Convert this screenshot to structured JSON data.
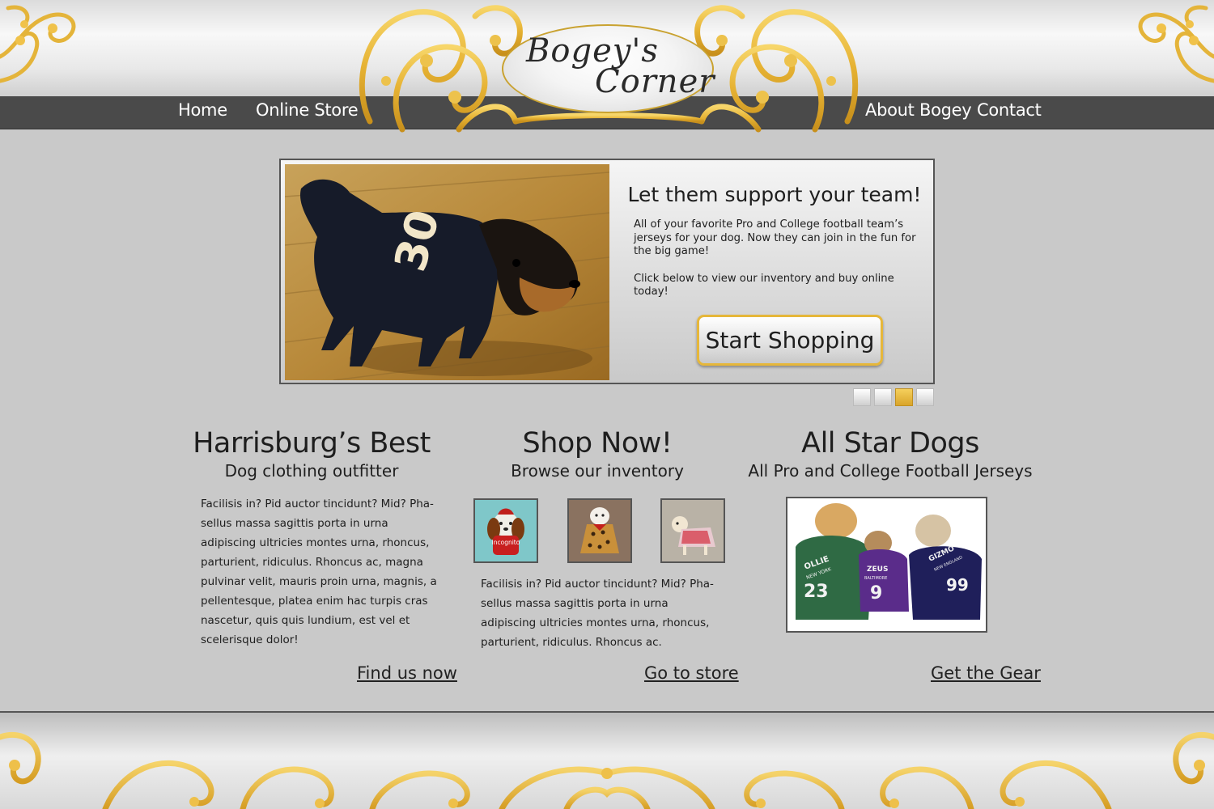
{
  "brand": {
    "logo_line1": "Bogey's",
    "logo_line2": "Corner"
  },
  "nav": {
    "home": "Home",
    "store": "Online Store",
    "about": "About Bogey",
    "contact": "Contact"
  },
  "hero": {
    "title": "Let them support your team!",
    "paragraph1": "All of your favorite Pro and College football team’s jerseys for your dog.  Now they can join in the fun for the big game!",
    "paragraph2": "Click below to view our inventory and buy online today!",
    "button_label": "Start Shopping",
    "slides_count": 4,
    "active_slide": 3
  },
  "columns": {
    "left": {
      "title": "Harrisburg’s Best",
      "subtitle": "Dog clothing outfitter",
      "text": "Facilisis in? Pid auctor tincidunt? Mid? Pha-sellus massa sagittis porta in urna adipiscing ultricies montes urna, rhoncus, parturient, ridiculus. Rhoncus ac, magna pulvinar velit, mauris proin urna, magnis, a pellentesque, platea enim hac turpis cras nascetur, quis quis lundium, est vel et scelerisque dolor!",
      "link": "Find us now"
    },
    "middle": {
      "title": "Shop Now!",
      "subtitle": "Browse our inventory",
      "text": "Facilisis in? Pid auctor tincidunt? Mid? Pha-sellus massa sagittis porta in urna adipiscing ultricies montes urna, rhoncus, parturient, ridiculus. Rhoncus ac.",
      "link": "Go to store"
    },
    "right": {
      "title": "All Star Dogs",
      "subtitle": "All Pro and College Football Jerseys",
      "link": "Get the Gear"
    }
  },
  "photo_text": {
    "hero_jersey": "30",
    "thumb1_label": "incognito",
    "jersey1_name": "OLLIE",
    "jersey1_city": "NEW YORK",
    "jersey1_number": "23",
    "jersey2_name": "ZEUS",
    "jersey2_city": "BALTIMORE",
    "jersey2_number": "9",
    "jersey3_name": "GIZMO",
    "jersey3_city": "NEW ENGLAND",
    "jersey3_number": "99"
  },
  "colors": {
    "gold": "#e8b737",
    "nav_bar": "#4a4a4a",
    "page_bg": "#c9c9c9",
    "text": "#1e1e1e"
  }
}
